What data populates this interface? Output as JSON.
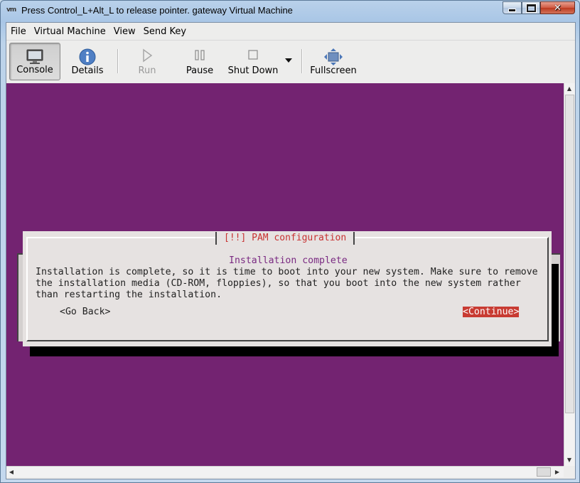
{
  "window": {
    "title": "Press Control_L+Alt_L to release pointer. gateway Virtual Machine",
    "app_icon_text": "vm",
    "controls": [
      "minimize",
      "maximize",
      "close"
    ]
  },
  "menubar": {
    "items": [
      "File",
      "Virtual Machine",
      "View",
      "Send Key"
    ]
  },
  "toolbar": {
    "console": "Console",
    "details": "Details",
    "run": "Run",
    "pause": "Pause",
    "shutdown": "Shut Down",
    "fullscreen": "Fullscreen"
  },
  "console": {
    "background": "#732371",
    "dialog": {
      "title": "[!!] PAM configuration",
      "heading": "Installation complete",
      "body": "Installation is complete, so it is time to boot into your new system. Make sure to remove\nthe installation media (CD-ROM, floppies), so that you boot into the new system rather\nthan restarting the installation.",
      "go_back": "<Go Back>",
      "continue": "<Continue>"
    }
  }
}
